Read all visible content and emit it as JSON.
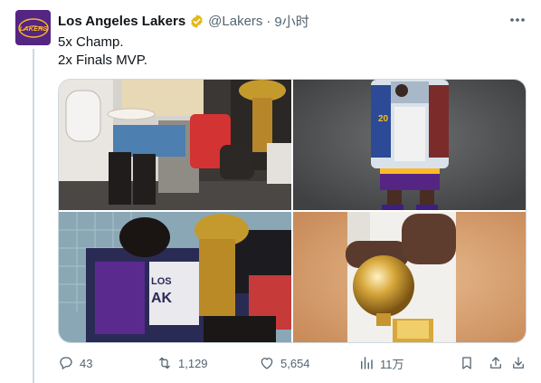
{
  "tweet": {
    "display_name": "Los Angeles Lakers",
    "handle": "@Lakers",
    "separator": "·",
    "time": "9小时",
    "lines": [
      "5x Champ.",
      "2x Finals MVP."
    ],
    "avatar_text": "LAKERS",
    "verified_color": "#e2b719",
    "avatar_color": "#552583"
  },
  "icons": {
    "more": "more-horizontal-icon",
    "verified": "verified-badge-icon",
    "reply": "reply-icon",
    "retweet": "retweet-icon",
    "like": "like-icon",
    "views": "views-icon",
    "bookmark": "bookmark-icon",
    "share": "share-icon",
    "download": "download-icon"
  },
  "actions": {
    "reply_count": "43",
    "retweet_count": "1,129",
    "like_count": "5,654",
    "views_count": "11万"
  },
  "media": {
    "photos": [
      {
        "subject": "player-on-airplane"
      },
      {
        "subject": "player-with-awards-portrait"
      },
      {
        "subject": "player-embracing-trophy"
      },
      {
        "subject": "player-hands-on-trophy"
      }
    ],
    "photo_jersey_text": [
      "20",
      "LOS",
      "AK"
    ]
  },
  "colors": {
    "text_primary": "#0f1419",
    "text_secondary": "#536471",
    "border": "#cfd9de",
    "lakers_purple": "#552583",
    "lakers_gold": "#fdb927"
  }
}
